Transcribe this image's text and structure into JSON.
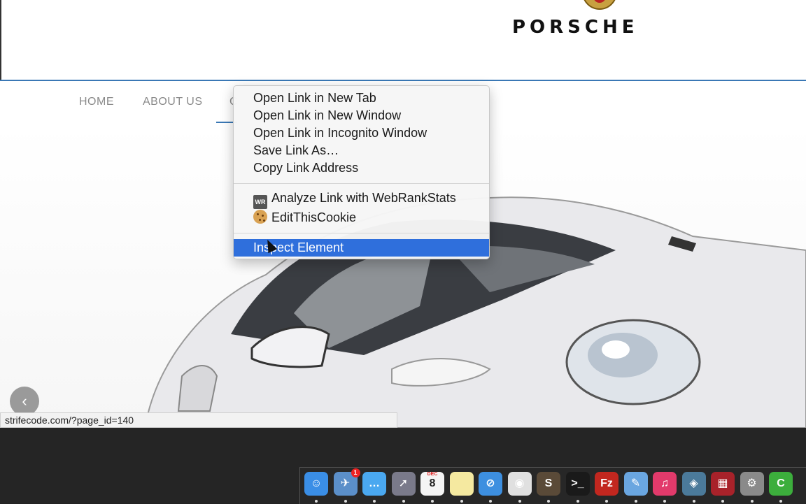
{
  "header": {
    "logo_text": "PORSCHE"
  },
  "nav": {
    "items": [
      {
        "label": "HOME"
      },
      {
        "label": "ABOUT US"
      },
      {
        "label": "C"
      }
    ]
  },
  "context_menu": {
    "items": [
      "Open Link in New Tab",
      "Open Link in New Window",
      "Open Link in Incognito Window",
      "Save Link As…",
      "Copy Link Address"
    ],
    "extensions": [
      {
        "label": "Analyze Link with WebRankStats",
        "icon": "webrankstats-icon",
        "icon_text": "WR"
      },
      {
        "label": "EditThisCookie",
        "icon": "cookie-icon"
      }
    ],
    "inspect_label": "Inspect Element",
    "highlight_color": "#2f6fdc"
  },
  "status_bar": {
    "url": "strifecode.com/?page_id=140"
  },
  "slider": {
    "prev_glyph": "‹"
  },
  "dock": {
    "icons": [
      {
        "name": "finder-icon",
        "color": "#3a8ee6",
        "glyph": "☺"
      },
      {
        "name": "preview-icon",
        "color": "#5b8fc9",
        "glyph": "✈",
        "badge": "1"
      },
      {
        "name": "messages-icon",
        "color": "#4aa8f0",
        "glyph": "…"
      },
      {
        "name": "launchpad-icon",
        "color": "#7a7a8a",
        "glyph": "➚"
      },
      {
        "name": "calendar-icon",
        "color": "#f4f4f4",
        "glyph": "8",
        "month": "DEC"
      },
      {
        "name": "notes-icon",
        "color": "#f5e9a0",
        "glyph": ""
      },
      {
        "name": "safari-icon",
        "color": "#3d8fe0",
        "glyph": "⊘"
      },
      {
        "name": "chrome-icon",
        "color": "#e0e0e0",
        "glyph": "◉"
      },
      {
        "name": "sublime-icon",
        "color": "#5a4a38",
        "glyph": "S"
      },
      {
        "name": "terminal-icon",
        "color": "#1a1a1a",
        "glyph": ">_"
      },
      {
        "name": "filezilla-icon",
        "color": "#c2271f",
        "glyph": "Fz"
      },
      {
        "name": "xcode-icon",
        "color": "#6aa6e0",
        "glyph": "✎"
      },
      {
        "name": "itunes-icon",
        "color": "#e23a6b",
        "glyph": "♫"
      },
      {
        "name": "image-capture-icon",
        "color": "#4b7a9a",
        "glyph": "◈"
      },
      {
        "name": "photo-booth-icon",
        "color": "#a8222a",
        "glyph": "▦"
      },
      {
        "name": "system-preferences-icon",
        "color": "#8a8a8a",
        "glyph": "⚙"
      },
      {
        "name": "camtasia-icon",
        "color": "#3cae3c",
        "glyph": "C"
      }
    ]
  }
}
